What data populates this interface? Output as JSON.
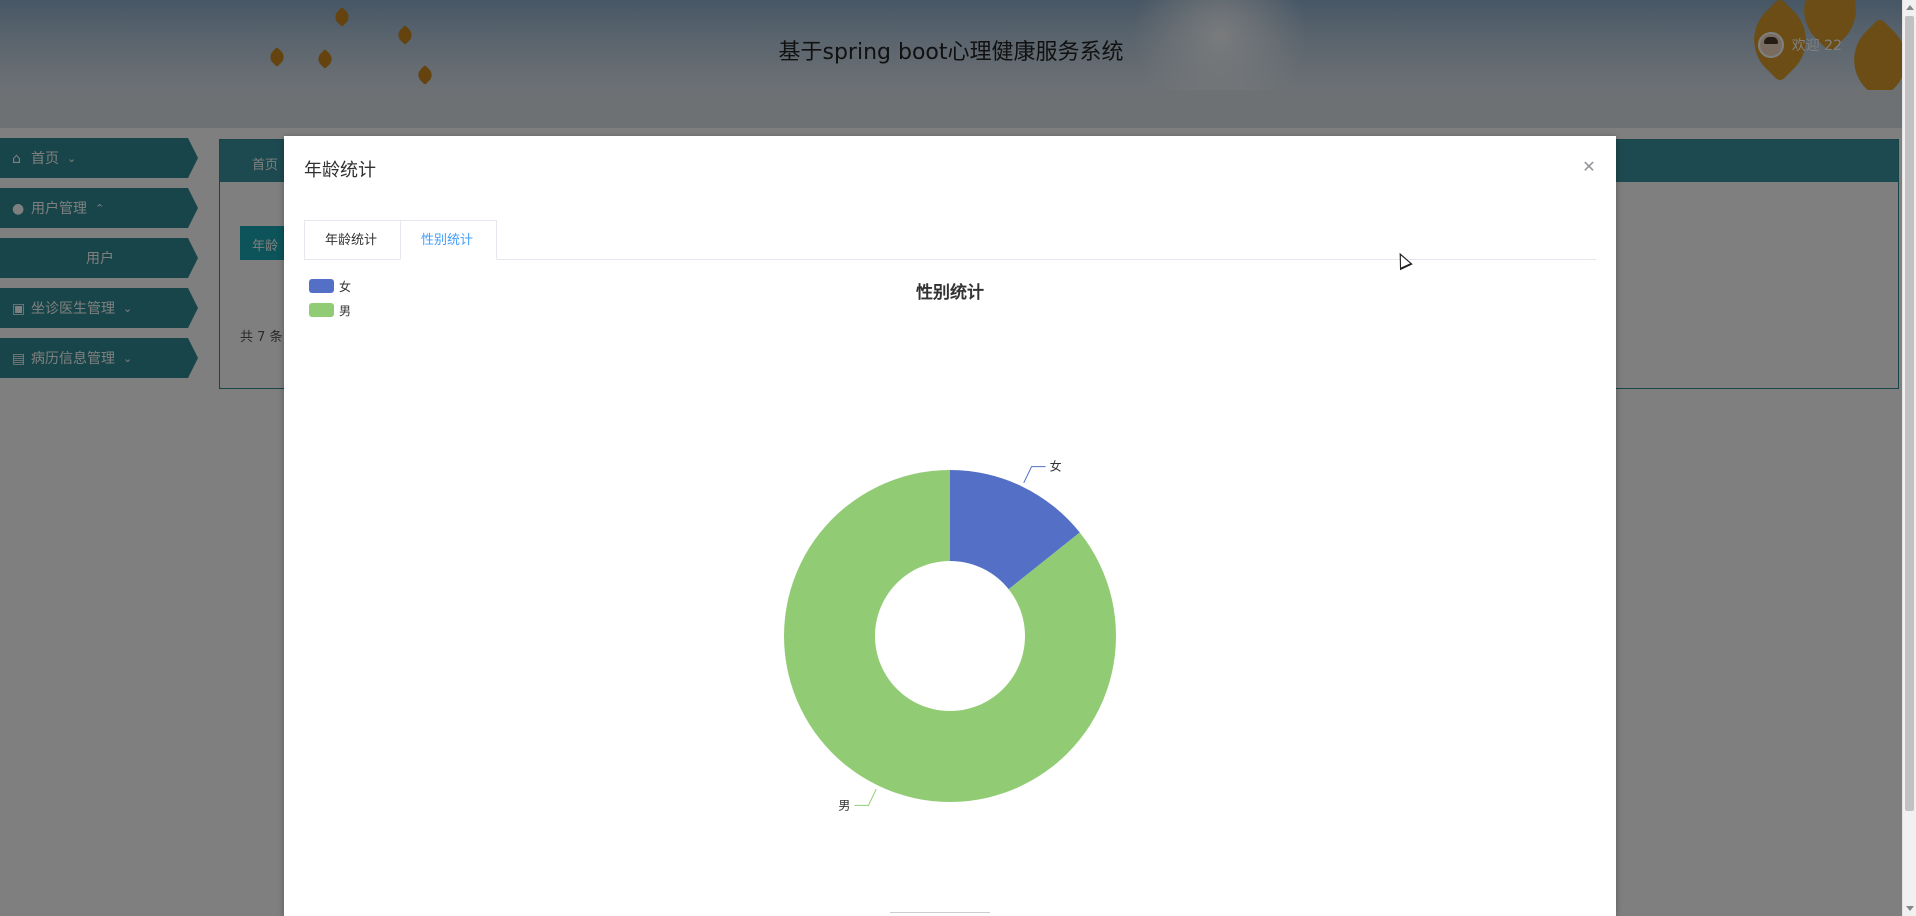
{
  "app": {
    "title": "基于spring boot心理健康服务系统",
    "welcome": "欢迎 22"
  },
  "sidebar": {
    "items": [
      {
        "label": "首页",
        "icon": "home-icon",
        "chevron": "⌄"
      },
      {
        "label": "用户管理",
        "icon": "user-icon",
        "chevron": "⌃"
      },
      {
        "label": "用户",
        "icon": "",
        "chevron": ""
      },
      {
        "label": "坐诊医生管理",
        "icon": "doctor-icon",
        "chevron": "⌄"
      },
      {
        "label": "病历信息管理",
        "icon": "record-icon",
        "chevron": "⌄"
      }
    ]
  },
  "content": {
    "header": "首页",
    "button": "年龄",
    "count": "共 7 条"
  },
  "dialog": {
    "title": "年龄统计",
    "close_icon": "close-icon",
    "tabs": [
      {
        "label": "年龄统计",
        "active": false
      },
      {
        "label": "性别统计",
        "active": true
      }
    ]
  },
  "chart_data": {
    "type": "pie",
    "variant": "donut",
    "title": "性别统计",
    "legend_position": "top-left",
    "slices": [
      {
        "label": "女",
        "value": 1,
        "color": "#5470c6"
      },
      {
        "label": "男",
        "value": 6,
        "color": "#91cc75"
      }
    ]
  },
  "colors": {
    "female": "#5470c6",
    "male": "#91cc75",
    "tab_active": "#409eff",
    "sidebar": "#2f8a93"
  }
}
